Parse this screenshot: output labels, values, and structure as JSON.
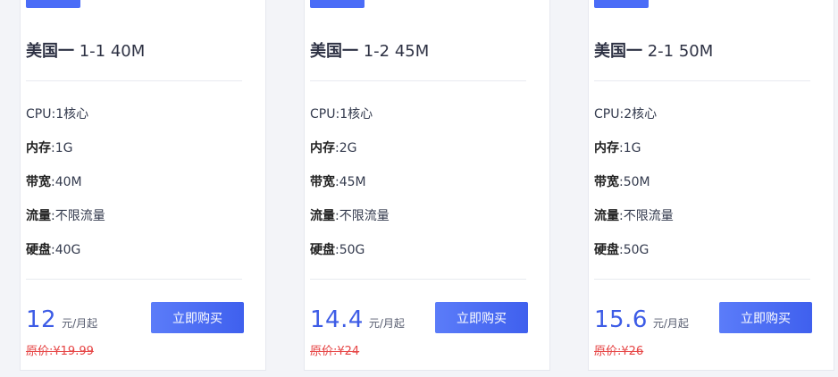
{
  "plans": [
    {
      "title_prefix": "美国一",
      "title_suffix": "1-1 40M",
      "cpu_key": "CPU:",
      "cpu_val": "1核心",
      "mem_key": "内存",
      "mem_val": ":1G",
      "bw_key": "带宽",
      "bw_val": ":40M",
      "traffic_key": "流量",
      "traffic_val": ":不限流量",
      "disk_key": "硬盘",
      "disk_val": ":40G",
      "price": "12",
      "unit": "元/月起",
      "original": "原价:¥19.99",
      "buy_label": "立即购买"
    },
    {
      "title_prefix": "美国一",
      "title_suffix": "1-2 45M",
      "cpu_key": "CPU:",
      "cpu_val": "1核心",
      "mem_key": "内存",
      "mem_val": ":2G",
      "bw_key": "带宽",
      "bw_val": ":45M",
      "traffic_key": "流量",
      "traffic_val": ":不限流量",
      "disk_key": "硬盘",
      "disk_val": ":50G",
      "price": "14.4",
      "unit": "元/月起",
      "original": "原价:¥24",
      "buy_label": "立即购买"
    },
    {
      "title_prefix": "美国一",
      "title_suffix": "2-1 50M",
      "cpu_key": "CPU:",
      "cpu_val": "2核心",
      "mem_key": "内存",
      "mem_val": ":1G",
      "bw_key": "带宽",
      "bw_val": ":50M",
      "traffic_key": "流量",
      "traffic_val": ":不限流量",
      "disk_key": "硬盘",
      "disk_val": ":50G",
      "price": "15.6",
      "unit": "元/月起",
      "original": "原价:¥26",
      "buy_label": "立即购买"
    }
  ],
  "colors": {
    "accent": "#4a6cf7",
    "price": "#3d5ce6",
    "original_price": "#e64545"
  }
}
